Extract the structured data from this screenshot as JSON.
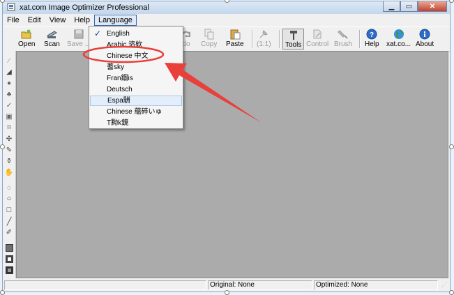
{
  "window": {
    "title": "xat.com  Image Optimizer Professional"
  },
  "menubar": [
    "File",
    "Edit",
    "View",
    "Help",
    "Language"
  ],
  "toolbar": {
    "open": "Open",
    "scan": "Scan",
    "save": "Save ...",
    "redo": "do",
    "copy": "Copy",
    "paste": "Paste",
    "zoom": "(1:1)",
    "tools": "Tools",
    "control": "Control",
    "brush": "Brush",
    "help": "Help",
    "xat": "xat.co...",
    "about": "About"
  },
  "language_menu": {
    "items": [
      "English",
      "Arabic 谘欸",
      "Chinese 中文",
      "蓍sky",
      "Fran錮is",
      "Deutsch",
      "Espa駲",
      "Chinese 蘊碎いゅ",
      "T黝k鏡"
    ],
    "checked_index": 0,
    "highlighted_index": 6,
    "circled_index": 2
  },
  "status": {
    "original": "Original: None",
    "optimized": "Optimized: None"
  },
  "colors": {
    "annotation": "#e8403a",
    "canvas": "#ababab",
    "menu_highlight": "#e4eefa"
  }
}
